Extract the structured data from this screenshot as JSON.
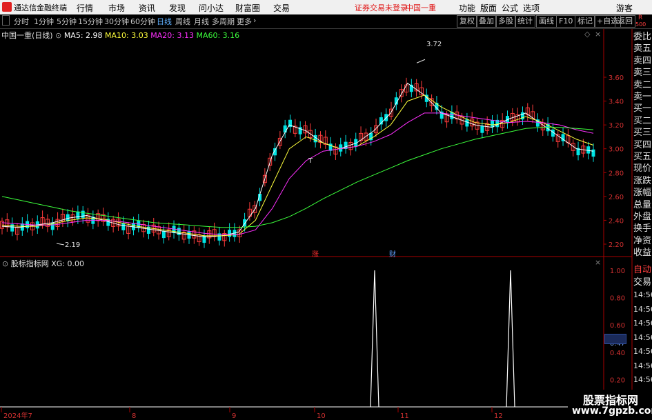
{
  "menu": {
    "app_title": "通达信金融终端",
    "items": [
      "行情",
      "市场",
      "资讯",
      "发现",
      "问小达",
      "财富圈",
      "交易"
    ],
    "warning": "证券交易未登录",
    "stock": "中国一重",
    "right_items": [
      "功能",
      "版面",
      "公式",
      "选项"
    ],
    "guest": "游客"
  },
  "toolbar": {
    "periods": [
      "分时",
      "1分钟",
      "5分钟",
      "15分钟",
      "30分钟",
      "60分钟",
      "日线",
      "周线",
      "月线",
      "多周期",
      "更多"
    ],
    "active_period": "日线",
    "buttons": [
      "复权",
      "叠加",
      "多股",
      "统计",
      "画线",
      "F10",
      "标记",
      "+自选",
      "返回"
    ],
    "right_badge": "R",
    "right_badge_num": "500"
  },
  "main_info": {
    "stock_label": "中国一重(日线)",
    "ma5": "MA5: 2.98",
    "ma10": "MA10: 3.03",
    "ma20": "MA20: 3.13",
    "ma60": "MA60: 3.16"
  },
  "sub_info": {
    "indicator": "股标指标网",
    "xg": "XG: 0.00"
  },
  "price_axis": [
    "3.60",
    "3.40",
    "3.20",
    "3.00",
    "2.80",
    "2.60",
    "2.40",
    "2.20"
  ],
  "sub_axis": [
    "1.00",
    "0.80",
    "0.60",
    "0.47",
    "0.40",
    "0.20"
  ],
  "date_axis": [
    "2024年7",
    "8",
    "9",
    "10",
    "11",
    "12"
  ],
  "annotations": {
    "high": "3.72",
    "low": "2.19",
    "zhang": "涨",
    "cai": "财",
    "t_mark": "T"
  },
  "right_panel": {
    "labels": [
      "委比",
      "卖五",
      "卖四",
      "卖三",
      "卖二",
      "卖一",
      "买一",
      "买二",
      "买三",
      "买四",
      "买五",
      "现价",
      "涨跌",
      "涨幅",
      "总量",
      "外盘",
      "换手",
      "净资",
      "收益"
    ],
    "sub_labels": [
      "自动",
      "交易"
    ],
    "times": [
      "14:56",
      "14:56",
      "14:56",
      "14:56",
      "14:56",
      "14:56",
      "14:56",
      "14:56"
    ]
  },
  "watermark": {
    "line1": "股票指标网",
    "line2": "www.7gpzb.com"
  },
  "colors": {
    "up": "#ff3c3c",
    "down": "#00e5e5",
    "ma5": "#ffffff",
    "ma10": "#ffff3c",
    "ma20": "#ff30ff",
    "ma60": "#3cff3c",
    "axis": "#d03030"
  },
  "chart_data": [
    {
      "type": "candlestick",
      "title": "中国一重(日线)",
      "ylim": [
        2.12,
        3.82
      ],
      "x": [
        "2024-07",
        "2024-08",
        "2024-09",
        "2024-10",
        "2024-11",
        "2024-12"
      ],
      "series": [
        {
          "name": "MA5",
          "values": [
            2.35,
            2.34,
            2.36,
            2.38,
            2.42,
            2.44,
            2.4,
            2.36,
            2.34,
            2.32,
            2.3,
            2.28,
            2.26,
            2.27,
            2.3,
            2.5,
            2.95,
            3.2,
            3.15,
            3.05,
            3.0,
            3.05,
            3.15,
            3.3,
            3.55,
            3.45,
            3.3,
            3.25,
            3.2,
            3.18,
            3.25,
            3.3,
            3.2,
            3.1,
            3.0,
            2.98
          ]
        },
        {
          "name": "MA10",
          "values": [
            2.36,
            2.35,
            2.35,
            2.37,
            2.4,
            2.42,
            2.41,
            2.38,
            2.35,
            2.33,
            2.31,
            2.29,
            2.27,
            2.27,
            2.28,
            2.4,
            2.7,
            3.0,
            3.1,
            3.05,
            3.0,
            3.02,
            3.1,
            3.2,
            3.4,
            3.45,
            3.35,
            3.28,
            3.22,
            3.2,
            3.22,
            3.27,
            3.22,
            3.15,
            3.08,
            3.03
          ]
        },
        {
          "name": "MA20",
          "values": [
            2.38,
            2.37,
            2.36,
            2.36,
            2.38,
            2.4,
            2.4,
            2.39,
            2.37,
            2.35,
            2.33,
            2.31,
            2.29,
            2.28,
            2.28,
            2.32,
            2.5,
            2.75,
            2.9,
            2.98,
            3.0,
            3.02,
            3.06,
            3.12,
            3.22,
            3.3,
            3.3,
            3.28,
            3.26,
            3.24,
            3.22,
            3.23,
            3.22,
            3.2,
            3.16,
            3.13
          ]
        },
        {
          "name": "MA60",
          "values": [
            2.6,
            2.57,
            2.54,
            2.51,
            2.48,
            2.46,
            2.44,
            2.42,
            2.4,
            2.38,
            2.37,
            2.36,
            2.35,
            2.34,
            2.34,
            2.35,
            2.38,
            2.43,
            2.5,
            2.58,
            2.65,
            2.72,
            2.78,
            2.84,
            2.9,
            2.95,
            3.0,
            3.04,
            3.08,
            3.11,
            3.14,
            3.17,
            3.18,
            3.18,
            3.17,
            3.16
          ]
        }
      ]
    },
    {
      "type": "line",
      "title": "XG",
      "ylim": [
        0,
        1.05
      ],
      "spikes": [
        {
          "at": "2024-10-31",
          "value": 1.0
        },
        {
          "at": "2024-12-12",
          "value": 1.0
        }
      ]
    }
  ]
}
